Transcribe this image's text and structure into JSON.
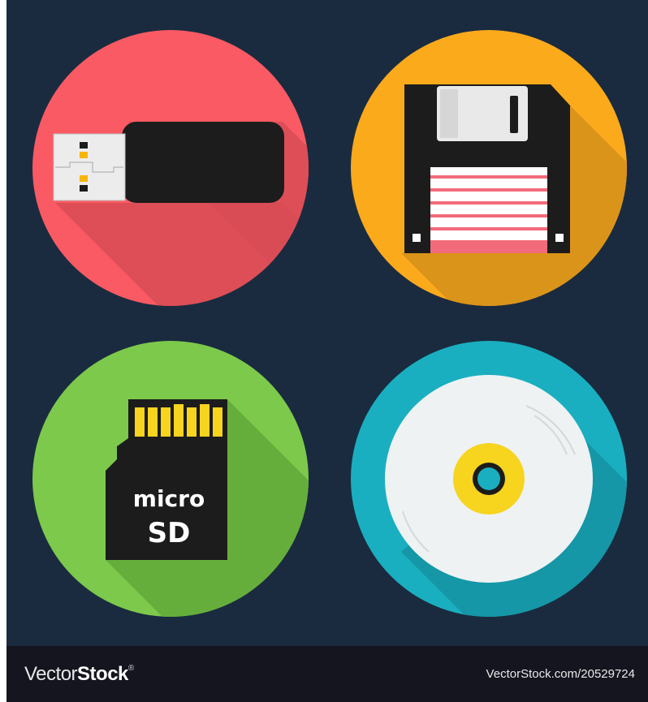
{
  "colors": {
    "background": "#1a2b3f",
    "footer": "#15151f",
    "usb_circle": "#fa5a63",
    "floppy_circle": "#fbaa1c",
    "microsd_circle": "#7dc94b",
    "disc_circle": "#1aafc0",
    "chip": "#1c1c1c",
    "gold": "#f7d41e"
  },
  "icons": [
    {
      "name": "usb-flash-drive-icon"
    },
    {
      "name": "floppy-disk-icon"
    },
    {
      "name": "micro-sd-card-icon"
    },
    {
      "name": "optical-disc-icon"
    }
  ],
  "microsd": {
    "line1": "micro",
    "line2": "SD"
  },
  "footer": {
    "brand_light": "Vector",
    "brand_bold": "Stock",
    "brand_mark": "®",
    "url": "VectorStock.com/20529724"
  }
}
